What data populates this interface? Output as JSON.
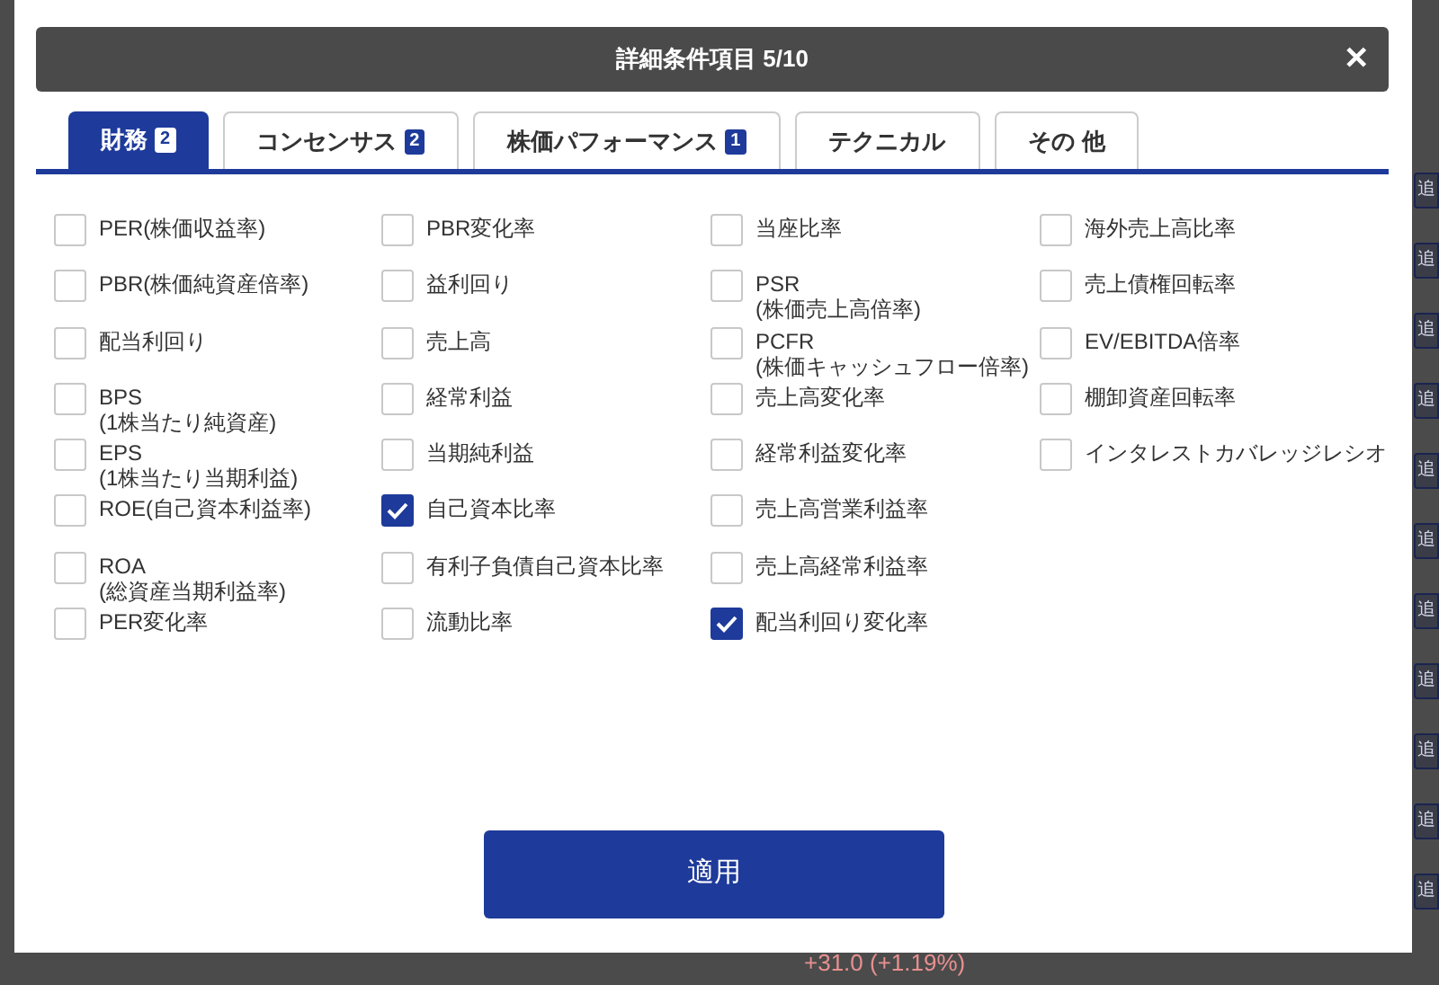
{
  "dialog": {
    "title": "詳細条件項目 5/10",
    "close": "✕"
  },
  "tabs": [
    {
      "label": "財務",
      "badge": "2",
      "selected": true
    },
    {
      "label": "コンセンサス",
      "badge": "2",
      "selected": false
    },
    {
      "label": "株価パフォーマンス",
      "badge": "1",
      "selected": false
    },
    {
      "label": "テクニカル",
      "selected": false
    },
    {
      "label": "その 他",
      "selected": false
    }
  ],
  "columns": [
    [
      {
        "label": "PER(株価収益率)",
        "checked": false
      },
      {
        "label": "PBR(株価純資産倍率)",
        "checked": false
      },
      {
        "label": "配当利回り",
        "checked": false
      },
      {
        "label": "BPS\n(1株当たり純資産)",
        "checked": false
      },
      {
        "label": "EPS\n(1株当たり当期利益)",
        "checked": false
      },
      {
        "label": "ROE(自己資本利益率)",
        "checked": false
      },
      {
        "label": "ROA\n(総資産当期利益率)",
        "checked": false
      },
      {
        "label": "PER変化率",
        "checked": false
      }
    ],
    [
      {
        "label": "PBR変化率",
        "checked": false
      },
      {
        "label": "益利回り",
        "checked": false
      },
      {
        "label": "売上高",
        "checked": false
      },
      {
        "label": "経常利益",
        "checked": false
      },
      {
        "label": "当期純利益",
        "checked": false
      },
      {
        "label": "自己資本比率",
        "checked": true
      },
      {
        "label": "有利子負債自己資本比率",
        "checked": false
      },
      {
        "label": "流動比率",
        "checked": false
      }
    ],
    [
      {
        "label": "当座比率",
        "checked": false
      },
      {
        "label": "PSR\n(株価売上高倍率)",
        "checked": false
      },
      {
        "label": "PCFR\n(株価キャッシュフロー倍率)",
        "checked": false
      },
      {
        "label": "売上高変化率",
        "checked": false
      },
      {
        "label": "経常利益変化率",
        "checked": false
      },
      {
        "label": "売上高営業利益率",
        "checked": false
      },
      {
        "label": "売上高経常利益率",
        "checked": false
      },
      {
        "label": "配当利回り変化率",
        "checked": true
      }
    ],
    [
      {
        "label": "海外売上高比率",
        "checked": false
      },
      {
        "label": "売上債権回転率",
        "checked": false
      },
      {
        "label": "EV/EBITDA倍率",
        "checked": false
      },
      {
        "label": "棚卸資産回転率",
        "checked": false
      },
      {
        "label": "インタレストカバレッジレシオ",
        "checked": false
      }
    ]
  ],
  "apply_button": "適用",
  "background": {
    "side_buttons": [
      "追",
      "追",
      "追",
      "追",
      "追",
      "追",
      "追",
      "追",
      "追",
      "追",
      "追"
    ],
    "change_text": "+31.0 (+1.19%)"
  }
}
